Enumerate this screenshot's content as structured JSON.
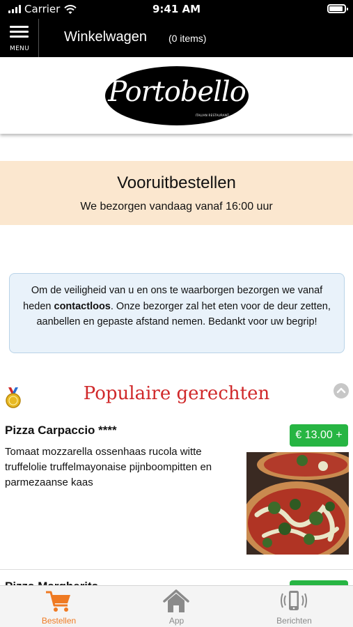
{
  "status_bar": {
    "carrier": "Carrier",
    "time": "9:41 AM"
  },
  "nav": {
    "menu_label": "MENU",
    "title": "Winkelwagen",
    "count": "(0 items)"
  },
  "brand": {
    "logo_text": "Portobello",
    "logo_subtext": "ITALIAN RESTAURANT"
  },
  "order_banner": {
    "title": "Vooruitbestellen",
    "subtitle": "We bezorgen vandaag vanaf 16:00 uur"
  },
  "notice": {
    "text_before": "Om de veiligheid van u en ons te waarborgen bezorgen we vanaf heden ",
    "bold": "contactloos",
    "text_after": ". Onze bezorger zal het eten voor de deur zetten, aanbellen en gepaste afstand nemen. Bedankt voor uw begrip!"
  },
  "popular": {
    "title": "Populaire gerechten"
  },
  "dishes": [
    {
      "name": "Pizza Carpaccio ****",
      "price": "€ 13.00 +",
      "description": "Tomaat mozzarella ossenhaas rucola witte truffelolie truffelmayonaise pijnboompitten en parmezaanse kaas"
    },
    {
      "name": "Pizza Margherita",
      "price": ""
    }
  ],
  "tabs": [
    {
      "label": "Bestellen",
      "icon": "cart-icon",
      "active": true
    },
    {
      "label": "App",
      "icon": "home-icon",
      "active": false
    },
    {
      "label": "Berichten",
      "icon": "phone-vibrate-icon",
      "active": false
    }
  ],
  "colors": {
    "accent_red": "#d0282a",
    "price_green": "#27b543",
    "active_tab": "#ef7a23",
    "banner_bg": "#fbe7cf",
    "notice_bg": "#e9f2fa"
  }
}
